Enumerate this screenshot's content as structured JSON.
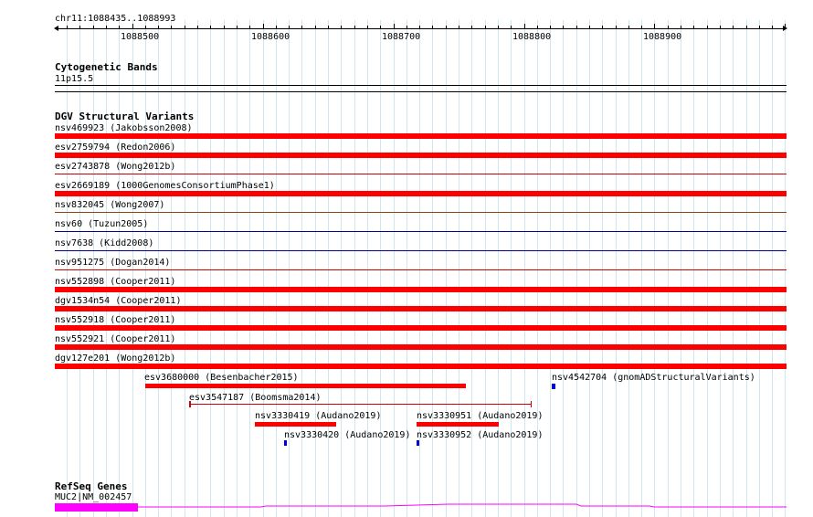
{
  "window": {
    "title": "chr11:1088435..1088993"
  },
  "ruler": {
    "label": "chr11:1088435..1088993",
    "ticks": [
      "1088500",
      "1088600",
      "1088700",
      "1088800",
      "1088900"
    ]
  },
  "tracks": {
    "cytogenetic_bands": {
      "title": "Cytogenetic Bands",
      "band": "11p15.5"
    },
    "dgv": {
      "title": "DGV Structural Variants",
      "full_width_items": [
        {
          "id": "nsv469923",
          "label": "nsv469923 (Jakobsson2008)",
          "color": "#ff0000",
          "style": "thick"
        },
        {
          "id": "esv2759794",
          "label": "esv2759794 (Redon2006)",
          "color": "#ff0000",
          "style": "thick"
        },
        {
          "id": "esv2743878",
          "label": "esv2743878 (Wong2012b)",
          "color": "#cc0000",
          "style": "thin"
        },
        {
          "id": "esv2669189",
          "label": "esv2669189 (1000GenomesConsortiumPhase1)",
          "color": "#ff0000",
          "style": "thick"
        },
        {
          "id": "nsv832045",
          "label": "nsv832045 (Wong2007)",
          "color": "#8b4513",
          "style": "thin"
        },
        {
          "id": "nsv60",
          "label": "nsv60 (Tuzun2005)",
          "color": "#00008b",
          "style": "thin"
        },
        {
          "id": "nsv7638",
          "label": "nsv7638 (Kidd2008)",
          "color": "#00008b",
          "style": "thin"
        },
        {
          "id": "nsv951275",
          "label": "nsv951275 (Dogan2014)",
          "color": "#cc0000",
          "style": "thin"
        },
        {
          "id": "nsv552898",
          "label": "nsv552898 (Cooper2011)",
          "color": "#ff0000",
          "style": "thick"
        },
        {
          "id": "dgv1534n54",
          "label": "dgv1534n54 (Cooper2011)",
          "color": "#ff0000",
          "style": "thick"
        },
        {
          "id": "nsv552918",
          "label": "nsv552918 (Cooper2011)",
          "color": "#ff0000",
          "style": "thick"
        },
        {
          "id": "nsv552921",
          "label": "nsv552921 (Cooper2011)",
          "color": "#ff0000",
          "style": "thick"
        },
        {
          "id": "dgv127e201",
          "label": "dgv127e201 (Wong2012b)",
          "color": "#ff0000",
          "style": "thick"
        }
      ],
      "partial_items": [
        {
          "id": "esv3680000",
          "label": "esv3680000 (Besenbacher2015)",
          "color": "#ff0000",
          "style": "thick"
        },
        {
          "id": "nsv4542704",
          "label": "nsv4542704 (gnomADStructuralVariants)",
          "color": "#0000cc",
          "style": "block"
        },
        {
          "id": "esv3547187",
          "label": "esv3547187 (Boomsma2014)",
          "color": "#cc0000",
          "style": "span"
        },
        {
          "id": "nsv3330419",
          "label": "nsv3330419 (Audano2019)",
          "color": "#ff0000",
          "style": "thick"
        },
        {
          "id": "nsv3330951",
          "label": "nsv3330951 (Audano2019)",
          "color": "#ff0000",
          "style": "thick"
        },
        {
          "id": "nsv3330420",
          "label": "nsv3330420 (Audano2019)",
          "color": "#0000cc",
          "style": "block"
        },
        {
          "id": "nsv3330952",
          "label": "nsv3330952 (Audano2019)",
          "color": "#0000cc",
          "style": "block"
        }
      ]
    },
    "refseq": {
      "title": "RefSeq Genes",
      "gene_label": "MUC2|NM_002457",
      "color": "#ff00ff"
    }
  }
}
